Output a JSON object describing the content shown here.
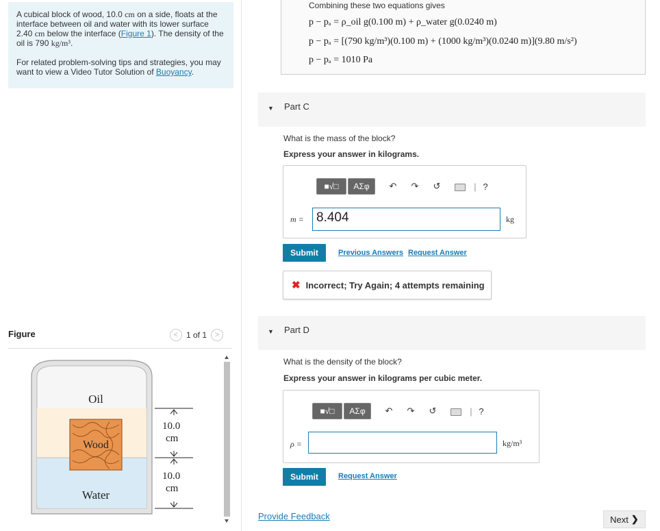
{
  "problem": {
    "text_main_1": "A cubical block of wood, 10.0 ",
    "unit_cm": "cm",
    "text_main_2": " on a side, floats at the interface between oil and water with its lower surface 2.40 ",
    "text_main_3": " below the interface (",
    "figure_link": "Figure 1",
    "text_main_4": "). The density of the oil is 790 ",
    "density_unit": "kg/m³",
    "text_main_5": ".",
    "tips_text": "For related problem-solving tips and strategies, you may want to view a Video Tutor Solution of ",
    "tips_link": "Buoyancy",
    "tips_end": "."
  },
  "figure": {
    "title": "Figure",
    "pager": "1 of 1",
    "prev_icon": "chevron-left-icon",
    "next_icon": "chevron-right-icon",
    "oil_label": "Oil",
    "wood_label": "Wood",
    "water_label": "Water",
    "dim_top_value": "10.0",
    "dim_top_unit": "cm",
    "dim_bottom_value": "10.0",
    "dim_bottom_unit": "cm",
    "colors": {
      "oil": "#fdf0dc",
      "water": "#d7eaf5",
      "wood": "#e8944f",
      "beaker": "#e0e0e0"
    }
  },
  "combining": {
    "intro": "Combining these two equations gives",
    "eq1": "p − pₐ = ρ_oil g(0.100 m) + ρ_water g(0.0240 m)",
    "eq2": "p − pₐ = [(790 kg/m³)(0.100 m) + (1000 kg/m³)(0.0240 m)](9.80 m/s²)",
    "eq3": "p − pₐ = 1010 Pa"
  },
  "partC": {
    "label": "Part C",
    "question": "What is the mass of the block?",
    "instruction": "Express your answer in kilograms.",
    "var": "m =",
    "value": "8.404",
    "unit": "kg",
    "toolbar": {
      "templates": "■√□",
      "greek": "ΑΣφ",
      "undo": "↶",
      "redo": "↷",
      "reset": "↺",
      "help": "?"
    },
    "submit": "Submit",
    "prev_answers": "Previous Answers",
    "request": "Request Answer",
    "feedback": "Incorrect; Try Again; 4 attempts remaining"
  },
  "partD": {
    "label": "Part D",
    "question": "What is the density of the block?",
    "instruction": "Express your answer in kilograms per cubic meter.",
    "var": "ρ =",
    "value": "",
    "unit": "kg/m³",
    "toolbar": {
      "templates": "■√□",
      "greek": "ΑΣφ",
      "undo": "↶",
      "redo": "↷",
      "reset": "↺",
      "help": "?"
    },
    "submit": "Submit",
    "request": "Request Answer"
  },
  "footer": {
    "feedback": "Provide Feedback",
    "next": "Next",
    "next_icon": "chevron-right-icon"
  }
}
